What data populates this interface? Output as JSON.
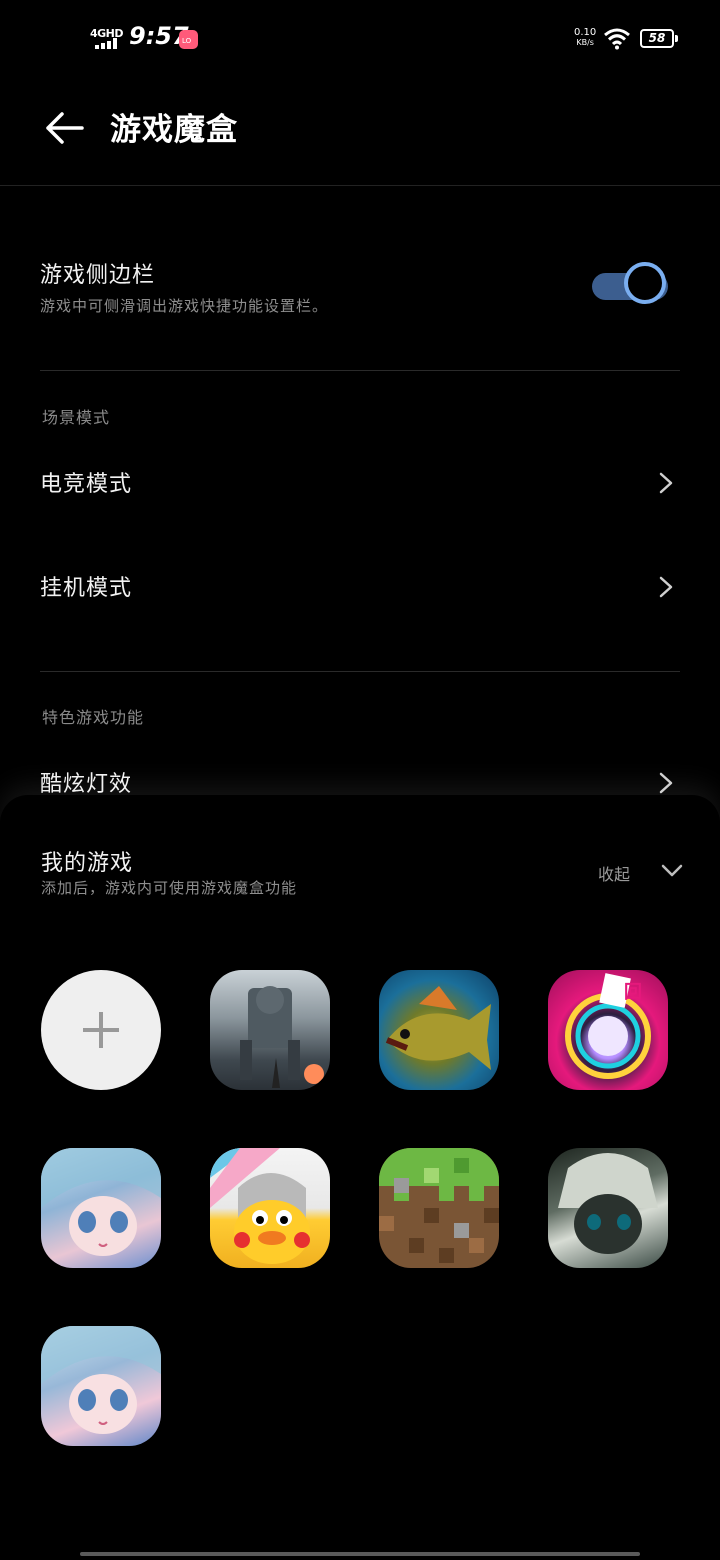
{
  "status_bar": {
    "network": "4GHD",
    "time": "9:57",
    "app_badge": "Lofter",
    "speed_value": "0.10",
    "speed_unit": "KB/s",
    "battery": "58"
  },
  "header": {
    "title": "游戏魔盒",
    "back_icon": "arrow-left-icon"
  },
  "settings": {
    "sidebar": {
      "title": "游戏侧边栏",
      "subtitle": "游戏中可侧滑调出游戏快捷功能设置栏。",
      "enabled": true,
      "toggle_color": "#7aaef0"
    },
    "scene_section": "场景模式",
    "esports_mode": "电竞模式",
    "afk_mode": "挂机模式",
    "feature_section": "特色游戏功能",
    "cool_light": "酷炫灯效"
  },
  "my_games": {
    "title": "我的游戏",
    "subtitle": "添加后，游戏内可使用游戏魔盒功能",
    "collapse_label": "收起",
    "add_icon": "plus-icon",
    "games": [
      {
        "icon": "war-game-icon"
      },
      {
        "icon": "fishing-game-icon"
      },
      {
        "icon": "rhythm-game-icon"
      },
      {
        "icon": "anime-girl-game-icon"
      },
      {
        "icon": "cartoon-duck-game-icon"
      },
      {
        "icon": "minecraft-game-icon"
      },
      {
        "icon": "anime-dark-game-icon"
      },
      {
        "icon": "anime-girl-game-icon-2"
      }
    ]
  }
}
